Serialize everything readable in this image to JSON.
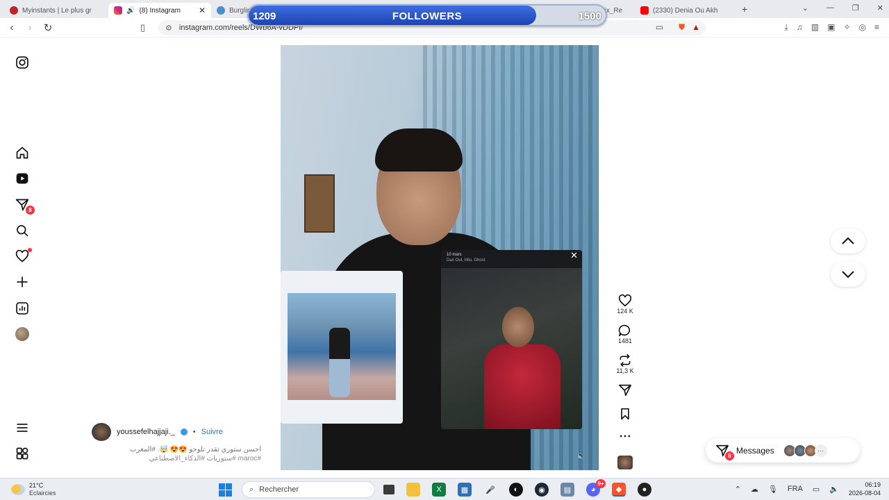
{
  "browser": {
    "tabs": [
      {
        "title": "Myinstants | Le plus gr",
        "color": "#c0242b"
      },
      {
        "title": "(8) Instagram",
        "color": "#d62976",
        "active": true
      },
      {
        "title": "Burglin",
        "color": "#4a90c8"
      },
      {
        "title": "BurglinGnomes_Fix_Re",
        "color": "#555555"
      },
      {
        "title": "(2330) Denia Ou Akh",
        "color": "#ff0000"
      }
    ],
    "url": "instagram.com/reels/DWb6A-vDDPf/"
  },
  "followers_overlay": {
    "current": "1209",
    "label": "FOLLOWERS",
    "goal": "1500",
    "progress_fraction": 0.806
  },
  "sidebar": {
    "notifications_badge": "8"
  },
  "reel": {
    "likes": "124 K",
    "comments": "1481",
    "reposts": "11,3 K",
    "story_date": "10 mars",
    "story_sub": "Dan Out, Hilu, Ghost"
  },
  "author": {
    "username": "youssefelhajjaji._",
    "separator": "•",
    "follow_label": "Suivre"
  },
  "caption": {
    "line1": "احسن ستوري تقدر تلوحو 😍😍 🤯. #المغرب",
    "line2": "#maroc #ستوريات #الذكاء_الاصطناعي"
  },
  "messages": {
    "label": "Messages",
    "badge": "8"
  },
  "taskbar": {
    "weather_temp": "21°C",
    "weather_desc": "Eclaircies",
    "search_placeholder": "Rechercher",
    "language": "FRA",
    "time": "06:19",
    "date": "2026-08-04",
    "discord_badge": "9+"
  }
}
